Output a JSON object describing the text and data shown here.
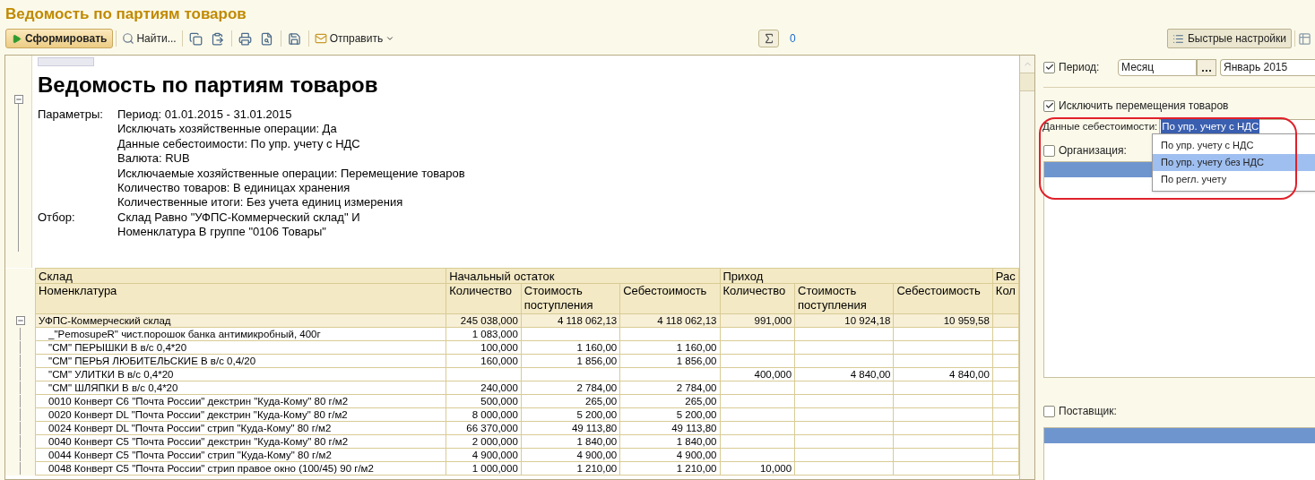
{
  "window": {
    "title": "Ведомость по партиям товаров"
  },
  "toolbar": {
    "items": [
      {
        "kind": "generate",
        "label": "Сформировать"
      },
      {
        "kind": "separator"
      },
      {
        "kind": "find",
        "label": "Найти..."
      },
      {
        "kind": "separator"
      },
      {
        "kind": "copy"
      },
      {
        "kind": "paste"
      },
      {
        "kind": "separator"
      },
      {
        "kind": "print"
      },
      {
        "kind": "preview"
      },
      {
        "kind": "separator"
      },
      {
        "kind": "save"
      },
      {
        "kind": "separator"
      },
      {
        "kind": "send",
        "label": "Отправить"
      }
    ],
    "sum_value": "0",
    "quick_settings": {
      "label": "Быстрые настройки",
      "selected": true
    }
  },
  "report": {
    "title": "Ведомость по партиям товаров",
    "params": [
      {
        "label": "Параметры:",
        "values": [
          "Период: 01.01.2015 - 31.01.2015",
          "Исключать хозяйственные операции: Да",
          "Данные себестоимости: По упр. учету с НДС",
          "Валюта: RUB",
          "Исключаемые хозяйственные операции: Перемещение товаров",
          "Количество товаров: В единицах хранения",
          "Количественные итоги: Без учета единиц измерения"
        ]
      },
      {
        "label": "Отбор:",
        "values": [
          "Склад Равно \"УФПС-Коммерческий склад\" И",
          "Номенклатура В группе \"0106 Товары\""
        ]
      }
    ],
    "table": {
      "group_headers": [
        "Склад",
        "Начальный остаток",
        "Приход",
        "Рас"
      ],
      "columns": [
        "Номенклатура",
        "Количество",
        "Стоимость поступления",
        "Себестоимость",
        "Количество",
        "Стоимость поступления",
        "Себестоимость",
        "Кол"
      ],
      "rows": [
        {
          "kind": "group",
          "expanded": true,
          "cells": [
            "УФПС-Коммерческий склад",
            "245 038,000",
            "4 118 062,13",
            "4 118 062,13",
            "991,000",
            "10 924,18",
            "10 959,58",
            ""
          ]
        },
        {
          "kind": "item",
          "cells": [
            "_\"PemosupeR\" чист.порошок банка антимикробный, 400г",
            "1 083,000",
            "",
            "",
            "",
            "",
            "",
            ""
          ]
        },
        {
          "kind": "item",
          "cells": [
            "\"СМ\" ПЕРЫШКИ В в/с 0,4*20",
            "100,000",
            "1 160,00",
            "1 160,00",
            "",
            "",
            "",
            ""
          ]
        },
        {
          "kind": "item",
          "cells": [
            "\"СМ\" ПЕРЬЯ ЛЮБИТЕЛЬСКИЕ В в/с 0,4/20",
            "160,000",
            "1 856,00",
            "1 856,00",
            "",
            "",
            "",
            ""
          ]
        },
        {
          "kind": "item",
          "cells": [
            "\"СМ\" УЛИТКИ В в/с 0,4*20",
            "",
            "",
            "",
            "400,000",
            "4 840,00",
            "4 840,00",
            ""
          ]
        },
        {
          "kind": "item",
          "cells": [
            "\"СМ\" ШЛЯПКИ В в/с 0,4*20",
            "240,000",
            "2 784,00",
            "2 784,00",
            "",
            "",
            "",
            ""
          ]
        },
        {
          "kind": "item",
          "cells": [
            "0010 Конверт С6 \"Почта России\" декстрин \"Куда-Кому\" 80 г/м2",
            "500,000",
            "265,00",
            "265,00",
            "",
            "",
            "",
            ""
          ]
        },
        {
          "kind": "item",
          "cells": [
            "0020 Конверт DL \"Почта России\" декстрин \"Куда-Кому\" 80 г/м2",
            "8 000,000",
            "5 200,00",
            "5 200,00",
            "",
            "",
            "",
            ""
          ]
        },
        {
          "kind": "item",
          "cells": [
            "0024 Конверт DL \"Почта России\" стрип \"Куда-Кому\" 80 г/м2",
            "66 370,000",
            "49 113,80",
            "49 113,80",
            "",
            "",
            "",
            ""
          ]
        },
        {
          "kind": "item",
          "cells": [
            "0040 Конверт С5 \"Почта России\" декстрин \"Куда-Кому\" 80 г/м2",
            "2 000,000",
            "1 840,00",
            "1 840,00",
            "",
            "",
            "",
            ""
          ]
        },
        {
          "kind": "item",
          "cells": [
            "0044 Конверт С5 \"Почта России\" стрип \"Куда-Кому\" 80 г/м2",
            "4 900,000",
            "4 900,00",
            "4 900,00",
            "",
            "",
            "",
            ""
          ]
        },
        {
          "kind": "item",
          "cells": [
            "0048 Конверт С5 \"Почта России\" стрип правое окно (100/45) 90 г/м2",
            "1 000,000",
            "1 210,00",
            "1 210,00",
            "10,000",
            "",
            "",
            ""
          ]
        }
      ]
    }
  },
  "settings": {
    "period": {
      "checked": true,
      "label": "Период:",
      "mode": "Месяц",
      "value": "Январь 2015"
    },
    "exclude_moves": {
      "checked": true,
      "label": "Исключить перемещения товаров"
    },
    "cost_data": {
      "label": "Данные себестоимости:",
      "value": "По упр. учету с НДС",
      "expanded": true,
      "options": [
        {
          "label": "По упр. учету с НДС",
          "highlighted": false
        },
        {
          "label": "По упр. учету без НДС",
          "highlighted": true
        },
        {
          "label": "По регл. учету",
          "highlighted": false
        }
      ]
    },
    "organization": {
      "checked": false,
      "label": "Организация:"
    },
    "supplier": {
      "checked": false,
      "label": "Поставщик:"
    }
  }
}
